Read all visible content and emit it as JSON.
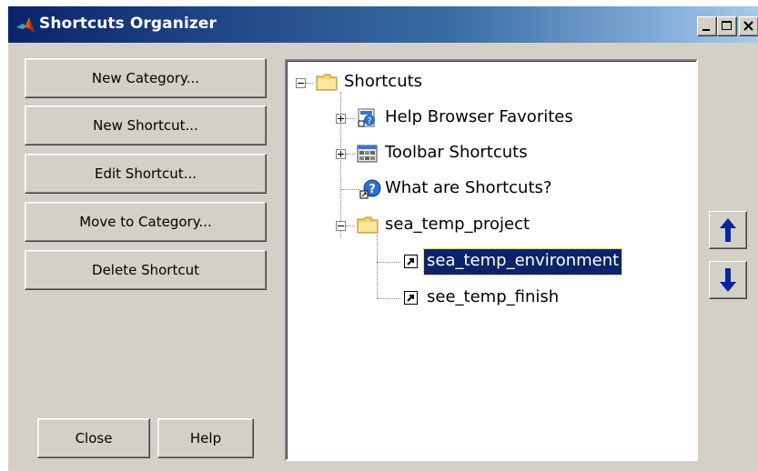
{
  "window": {
    "title": "Shortcuts Organizer",
    "controls": [
      "minimize",
      "maximize",
      "close"
    ]
  },
  "buttons": {
    "new_category": "New Category...",
    "new_shortcut": "New Shortcut...",
    "edit_shortcut": "Edit Shortcut...",
    "move_to_category": "Move to Category...",
    "delete_shortcut": "Delete Shortcut",
    "close": "Close",
    "help": "Help"
  },
  "tree": {
    "root": {
      "label": "Shortcuts",
      "icon": "folder-icon",
      "expanded": true
    },
    "items": [
      {
        "label": "Help Browser Favorites",
        "icon": "help-favorites-icon",
        "expandable": true,
        "expanded": false
      },
      {
        "label": "Toolbar Shortcuts",
        "icon": "toolbar-icon",
        "expandable": true,
        "expanded": false
      },
      {
        "label": "What are Shortcuts?",
        "icon": "help-icon",
        "expandable": false
      },
      {
        "label": "sea_temp_project",
        "icon": "folder-icon",
        "expandable": true,
        "expanded": true,
        "children": [
          {
            "label": "sea_temp_environment",
            "icon": "shortcut-icon",
            "selected": true
          },
          {
            "label": "see_temp_finish",
            "icon": "shortcut-icon",
            "selected": false
          }
        ]
      }
    ]
  },
  "side_buttons": {
    "move_up_icon": "arrow-up-icon",
    "move_down_icon": "arrow-down-icon"
  },
  "colors": {
    "title_gradient_start": "#0a246a",
    "title_gradient_end": "#a6caf0",
    "selection": "#0a246a",
    "dialog_face": "#d4d0c8",
    "arrow_blue": "#0a24a0"
  }
}
